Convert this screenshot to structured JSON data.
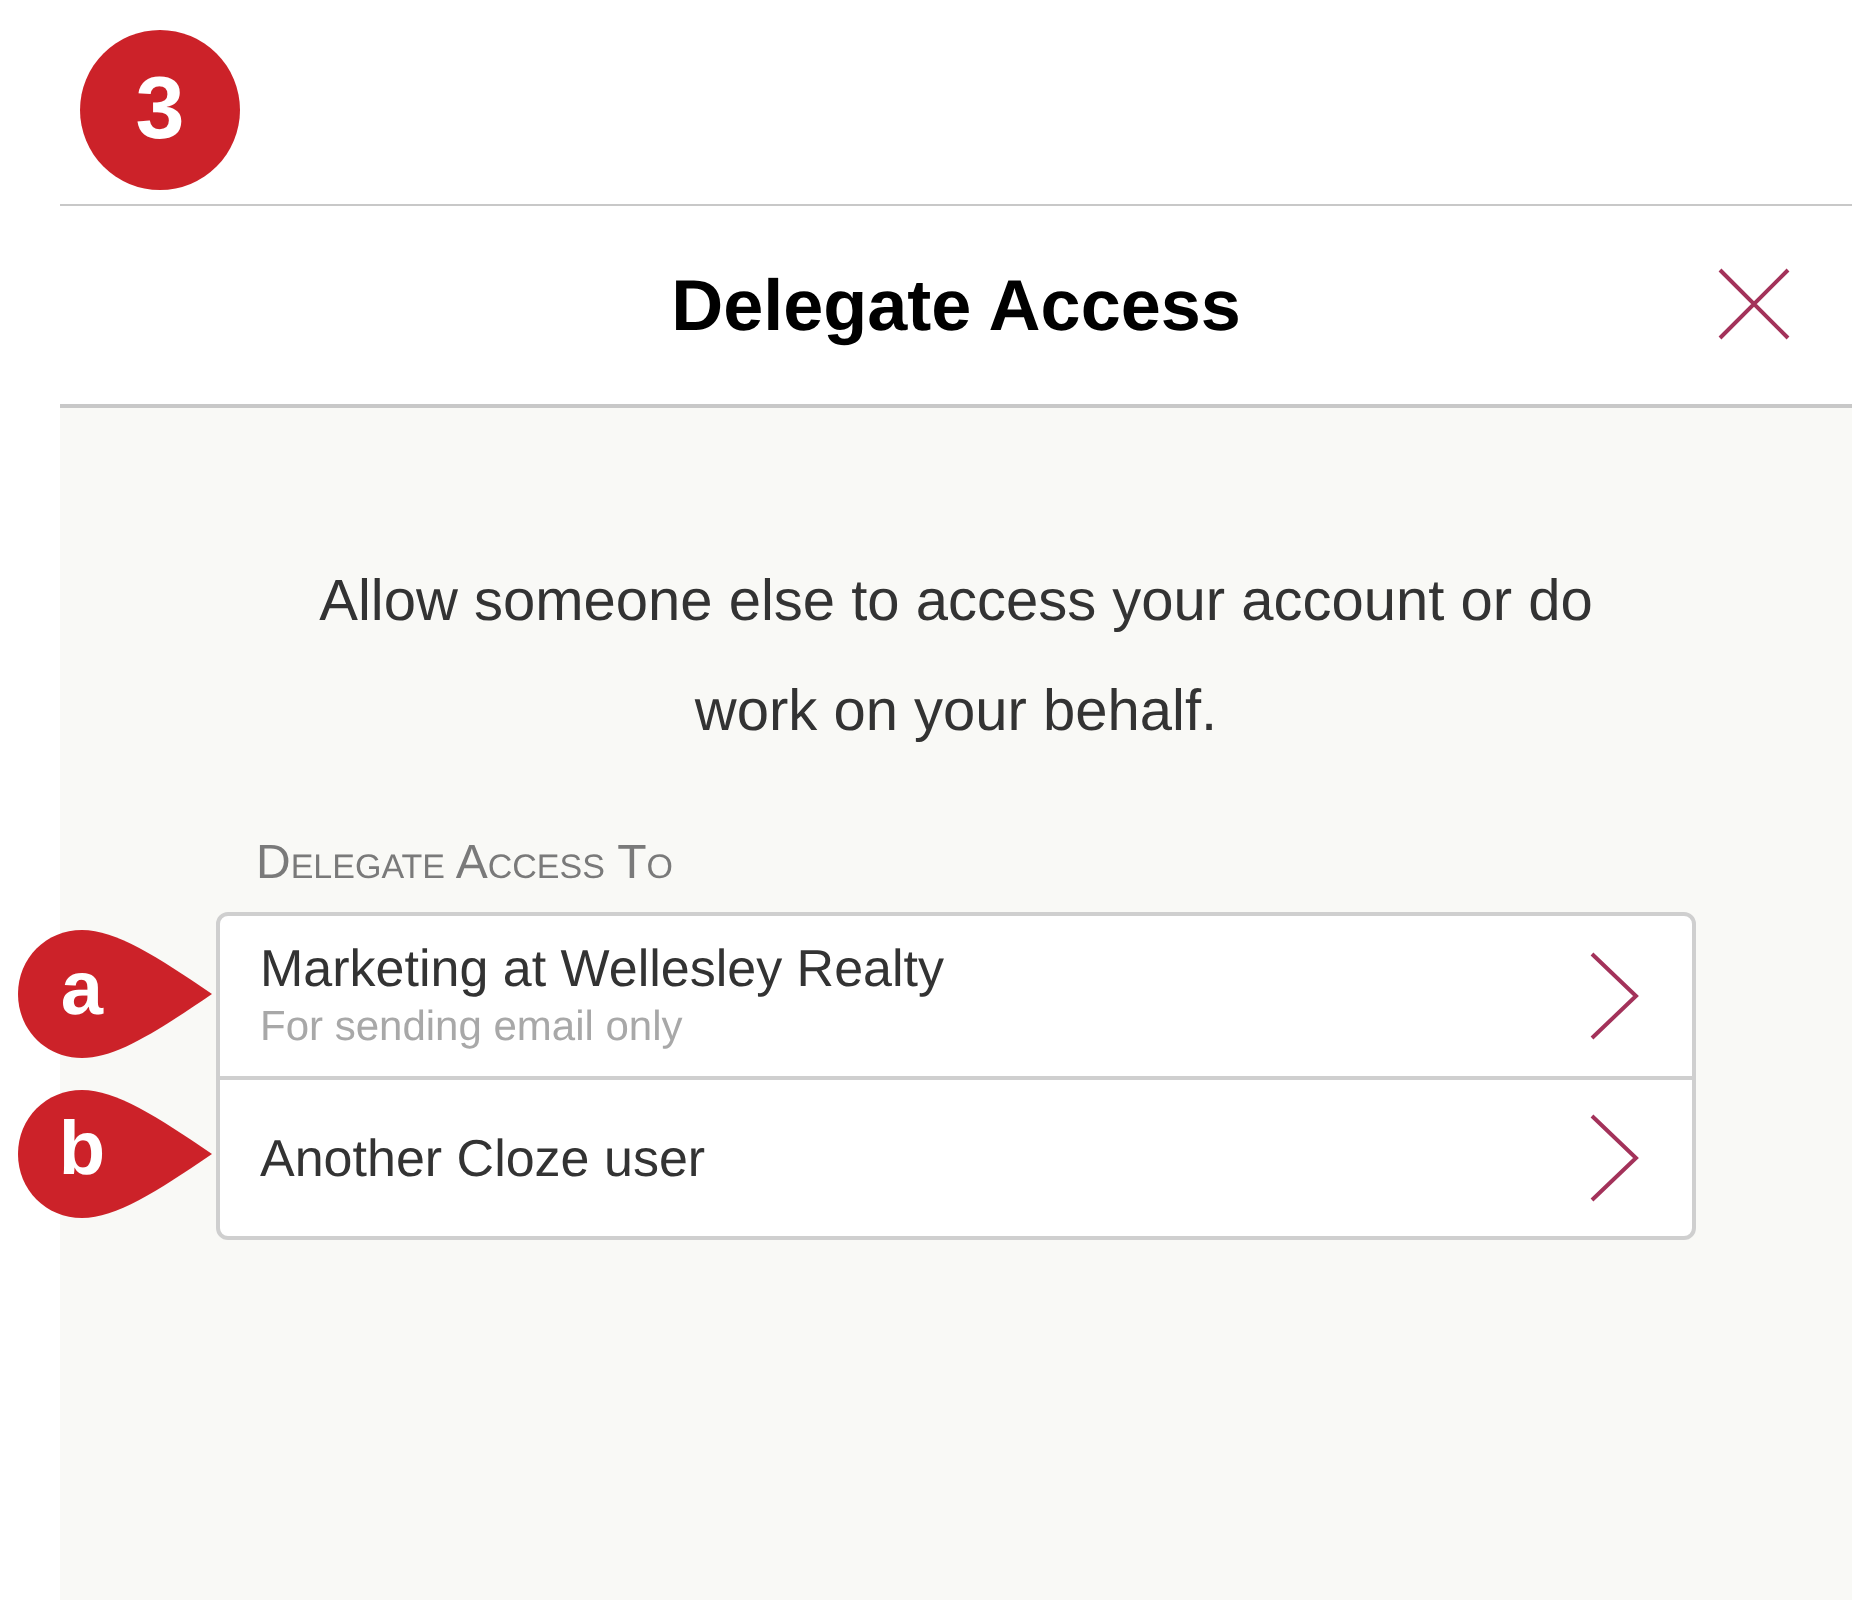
{
  "step_badge": "3",
  "dialog": {
    "title": "Delegate Access",
    "description": "Allow someone else to access your account or do work on your behalf.",
    "section_label": "Delegate Access To",
    "options": [
      {
        "marker": "a",
        "title": "Marketing at Wellesley Realty",
        "subtitle": "For sending email only"
      },
      {
        "marker": "b",
        "title": "Another Cloze user"
      }
    ]
  }
}
